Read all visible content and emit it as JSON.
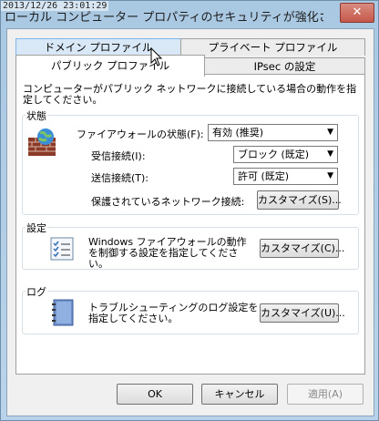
{
  "overlay_timestamp": "2013/12/26 23:01:29",
  "window": {
    "title": "ローカル コンピューター プロパティのセキュリティが強化された ...",
    "close_label": "✕"
  },
  "tabs": {
    "domain": "ドメイン プロファイル",
    "private": "プライベート プロファイル",
    "public": "パブリック プロファイル",
    "ipsec": "IPsec の設定"
  },
  "description": "コンピューターがパブリック ネットワークに接続している場合の動作を指定してください。",
  "state_group": {
    "label": "状態",
    "firewall_state_label": "ファイアウォールの状態(F):",
    "firewall_state_value": "有効 (推奨)",
    "inbound_label": "受信接続(I):",
    "inbound_value": "ブロック (既定)",
    "outbound_label": "送信接続(T):",
    "outbound_value": "許可 (既定)",
    "protected_label": "保護されているネットワーク接続:",
    "protected_button": "カスタマイズ(S)..."
  },
  "settings_group": {
    "label": "設定",
    "text": "Windows ファイアウォールの動作を制御する設定を指定してください。",
    "button": "カスタマイズ(C)..."
  },
  "log_group": {
    "label": "ログ",
    "text": "トラブルシューティングのログ設定を指定してください。",
    "button": "カスタマイズ(U)..."
  },
  "dialog_buttons": {
    "ok": "OK",
    "cancel": "キャンセル",
    "apply": "適用(A)"
  },
  "icons": {
    "firewall": "firewall-brick-globe-icon",
    "settings": "checklist-icon",
    "log": "notebook-icon",
    "cursor": "mouse-pointer-icon"
  }
}
